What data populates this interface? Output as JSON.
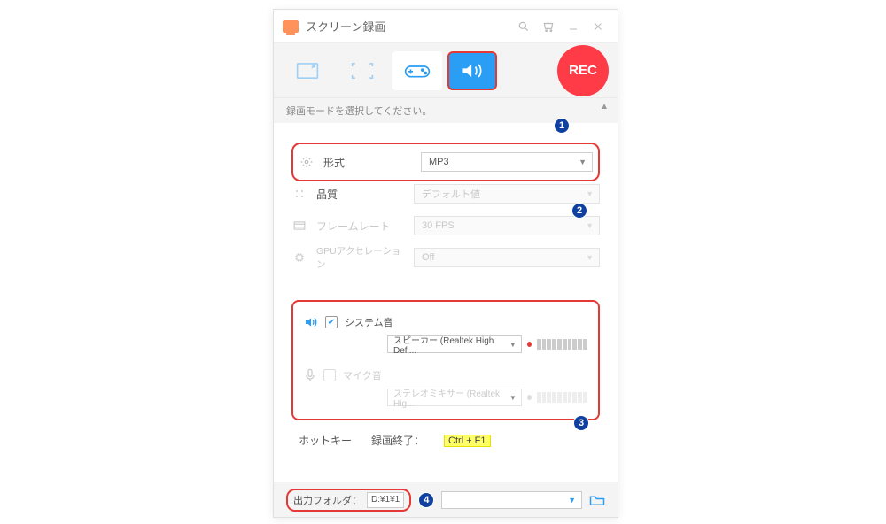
{
  "titlebar": {
    "app_title": "スクリーン録画"
  },
  "modebar": {
    "rec_label": "REC"
  },
  "mode_hint": "録画モードを選択してください。",
  "settings": {
    "format": {
      "label": "形式",
      "value": "MP3"
    },
    "quality": {
      "label": "品質",
      "value": "デフォルト値"
    },
    "framerate": {
      "label": "フレームレート",
      "value": "30 FPS"
    },
    "gpu": {
      "label": "GPUアクセレーション",
      "value": "Off"
    }
  },
  "audio": {
    "system": {
      "label": "システム音",
      "device": "スピーカー (Realtek High Defi...",
      "checked": true
    },
    "mic": {
      "label": "マイク音",
      "device": "ステレオミキサー (Realtek Hig...",
      "checked": false
    }
  },
  "hotkey": {
    "title": "ホットキー",
    "end_label": "録画終了：",
    "end_key": "Ctrl + F1"
  },
  "output": {
    "label": "出力フォルダ：",
    "path": "D:¥1¥1"
  },
  "badges": {
    "b1": "1",
    "b2": "2",
    "b3": "3",
    "b4": "4"
  }
}
